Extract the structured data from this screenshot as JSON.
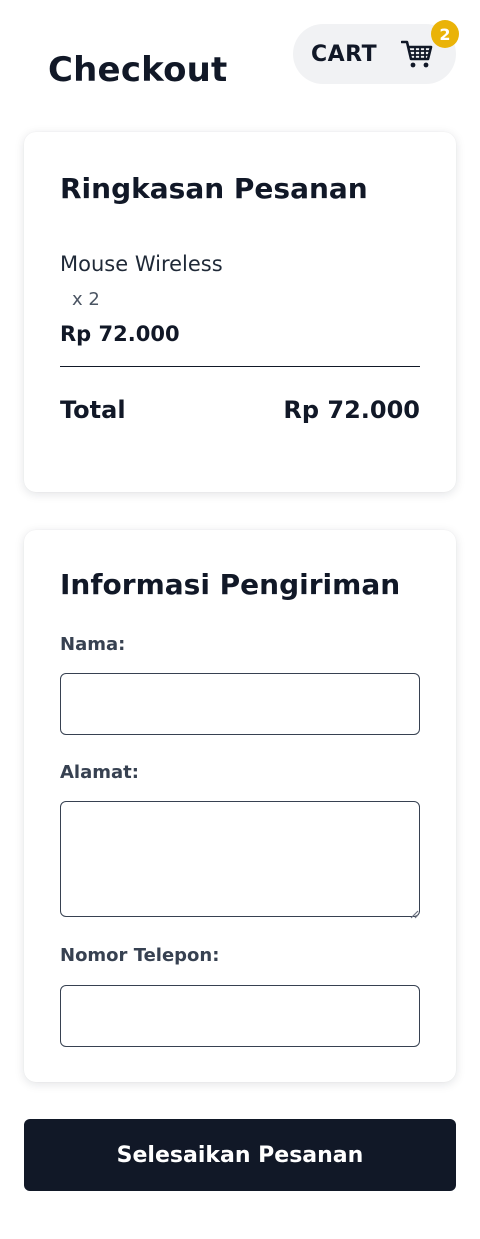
{
  "header": {
    "title": "Checkout",
    "cart": {
      "label": "CART",
      "icon": "shopping-cart-icon",
      "count": "2",
      "badge_color": "#eab308"
    }
  },
  "summary": {
    "title": "Ringkasan Pesanan",
    "items": [
      {
        "name": "Mouse Wireless",
        "quantity": "x 2",
        "price": "Rp 72.000"
      }
    ],
    "total_label": "Total",
    "total_value": "Rp 72.000"
  },
  "shipping": {
    "title": "Informasi Pengiriman",
    "fields": {
      "name": {
        "label": "Nama:",
        "value": "",
        "placeholder": ""
      },
      "address": {
        "label": "Alamat:",
        "value": "",
        "placeholder": ""
      },
      "phone": {
        "label": "Nomor Telepon:",
        "value": "",
        "placeholder": ""
      }
    }
  },
  "actions": {
    "submit_label": "Selesaikan Pesanan"
  },
  "colors": {
    "primary": "#111827",
    "badge": "#eab308",
    "cart_bg": "#f1f2f4"
  }
}
